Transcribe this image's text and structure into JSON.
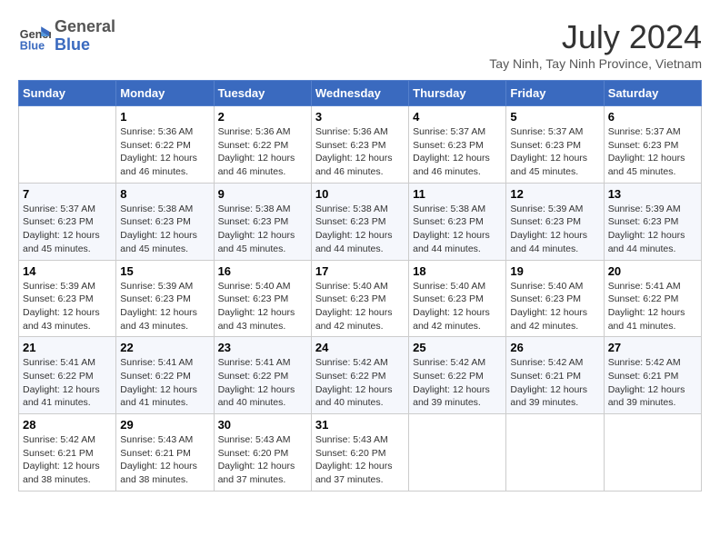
{
  "logo": {
    "line1": "General",
    "line2": "Blue"
  },
  "title": "July 2024",
  "location": "Tay Ninh, Tay Ninh Province, Vietnam",
  "weekdays": [
    "Sunday",
    "Monday",
    "Tuesday",
    "Wednesday",
    "Thursday",
    "Friday",
    "Saturday"
  ],
  "weeks": [
    [
      {
        "day": "",
        "content": ""
      },
      {
        "day": "1",
        "content": "Sunrise: 5:36 AM\nSunset: 6:22 PM\nDaylight: 12 hours\nand 46 minutes."
      },
      {
        "day": "2",
        "content": "Sunrise: 5:36 AM\nSunset: 6:22 PM\nDaylight: 12 hours\nand 46 minutes."
      },
      {
        "day": "3",
        "content": "Sunrise: 5:36 AM\nSunset: 6:23 PM\nDaylight: 12 hours\nand 46 minutes."
      },
      {
        "day": "4",
        "content": "Sunrise: 5:37 AM\nSunset: 6:23 PM\nDaylight: 12 hours\nand 46 minutes."
      },
      {
        "day": "5",
        "content": "Sunrise: 5:37 AM\nSunset: 6:23 PM\nDaylight: 12 hours\nand 45 minutes."
      },
      {
        "day": "6",
        "content": "Sunrise: 5:37 AM\nSunset: 6:23 PM\nDaylight: 12 hours\nand 45 minutes."
      }
    ],
    [
      {
        "day": "7",
        "content": "Sunrise: 5:37 AM\nSunset: 6:23 PM\nDaylight: 12 hours\nand 45 minutes."
      },
      {
        "day": "8",
        "content": "Sunrise: 5:38 AM\nSunset: 6:23 PM\nDaylight: 12 hours\nand 45 minutes."
      },
      {
        "day": "9",
        "content": "Sunrise: 5:38 AM\nSunset: 6:23 PM\nDaylight: 12 hours\nand 45 minutes."
      },
      {
        "day": "10",
        "content": "Sunrise: 5:38 AM\nSunset: 6:23 PM\nDaylight: 12 hours\nand 44 minutes."
      },
      {
        "day": "11",
        "content": "Sunrise: 5:38 AM\nSunset: 6:23 PM\nDaylight: 12 hours\nand 44 minutes."
      },
      {
        "day": "12",
        "content": "Sunrise: 5:39 AM\nSunset: 6:23 PM\nDaylight: 12 hours\nand 44 minutes."
      },
      {
        "day": "13",
        "content": "Sunrise: 5:39 AM\nSunset: 6:23 PM\nDaylight: 12 hours\nand 44 minutes."
      }
    ],
    [
      {
        "day": "14",
        "content": "Sunrise: 5:39 AM\nSunset: 6:23 PM\nDaylight: 12 hours\nand 43 minutes."
      },
      {
        "day": "15",
        "content": "Sunrise: 5:39 AM\nSunset: 6:23 PM\nDaylight: 12 hours\nand 43 minutes."
      },
      {
        "day": "16",
        "content": "Sunrise: 5:40 AM\nSunset: 6:23 PM\nDaylight: 12 hours\nand 43 minutes."
      },
      {
        "day": "17",
        "content": "Sunrise: 5:40 AM\nSunset: 6:23 PM\nDaylight: 12 hours\nand 42 minutes."
      },
      {
        "day": "18",
        "content": "Sunrise: 5:40 AM\nSunset: 6:23 PM\nDaylight: 12 hours\nand 42 minutes."
      },
      {
        "day": "19",
        "content": "Sunrise: 5:40 AM\nSunset: 6:23 PM\nDaylight: 12 hours\nand 42 minutes."
      },
      {
        "day": "20",
        "content": "Sunrise: 5:41 AM\nSunset: 6:22 PM\nDaylight: 12 hours\nand 41 minutes."
      }
    ],
    [
      {
        "day": "21",
        "content": "Sunrise: 5:41 AM\nSunset: 6:22 PM\nDaylight: 12 hours\nand 41 minutes."
      },
      {
        "day": "22",
        "content": "Sunrise: 5:41 AM\nSunset: 6:22 PM\nDaylight: 12 hours\nand 41 minutes."
      },
      {
        "day": "23",
        "content": "Sunrise: 5:41 AM\nSunset: 6:22 PM\nDaylight: 12 hours\nand 40 minutes."
      },
      {
        "day": "24",
        "content": "Sunrise: 5:42 AM\nSunset: 6:22 PM\nDaylight: 12 hours\nand 40 minutes."
      },
      {
        "day": "25",
        "content": "Sunrise: 5:42 AM\nSunset: 6:22 PM\nDaylight: 12 hours\nand 39 minutes."
      },
      {
        "day": "26",
        "content": "Sunrise: 5:42 AM\nSunset: 6:21 PM\nDaylight: 12 hours\nand 39 minutes."
      },
      {
        "day": "27",
        "content": "Sunrise: 5:42 AM\nSunset: 6:21 PM\nDaylight: 12 hours\nand 39 minutes."
      }
    ],
    [
      {
        "day": "28",
        "content": "Sunrise: 5:42 AM\nSunset: 6:21 PM\nDaylight: 12 hours\nand 38 minutes."
      },
      {
        "day": "29",
        "content": "Sunrise: 5:43 AM\nSunset: 6:21 PM\nDaylight: 12 hours\nand 38 minutes."
      },
      {
        "day": "30",
        "content": "Sunrise: 5:43 AM\nSunset: 6:20 PM\nDaylight: 12 hours\nand 37 minutes."
      },
      {
        "day": "31",
        "content": "Sunrise: 5:43 AM\nSunset: 6:20 PM\nDaylight: 12 hours\nand 37 minutes."
      },
      {
        "day": "",
        "content": ""
      },
      {
        "day": "",
        "content": ""
      },
      {
        "day": "",
        "content": ""
      }
    ]
  ]
}
